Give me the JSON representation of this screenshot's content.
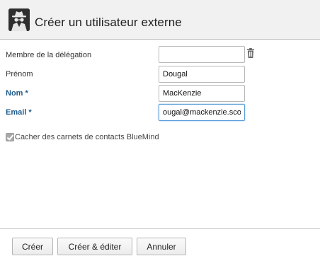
{
  "dialog": {
    "title": "Créer un utilisateur externe",
    "header_icon": "incognito-spy-icon"
  },
  "form": {
    "delegation": {
      "label": "Membre de la délégation",
      "value": "",
      "delete_icon": "trash-icon"
    },
    "firstname": {
      "label": "Prénom",
      "value": "Dougal"
    },
    "lastname": {
      "label": "Nom *",
      "value": "MacKenzie"
    },
    "email": {
      "label": "Email *",
      "value": "ougal@mackenzie.scot"
    },
    "hide_addressbooks": {
      "label": "Cacher des carnets de contacts BlueMind",
      "checked": true
    }
  },
  "footer": {
    "create_label": "Créer",
    "create_edit_label": "Créer & éditer",
    "cancel_label": "Annuler"
  },
  "colors": {
    "required_label": "#1f5a8a",
    "focus_border": "#5b9dd9",
    "header_bg": "#f1f1f1"
  }
}
